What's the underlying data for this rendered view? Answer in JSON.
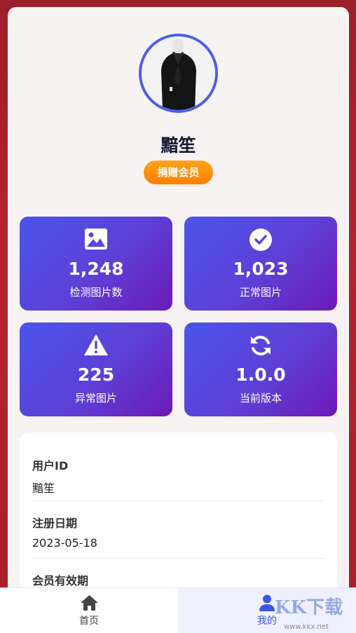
{
  "profile": {
    "name": "黯笙",
    "badge": "捐赠会员"
  },
  "stats": [
    {
      "icon": "image-icon",
      "value": "1,248",
      "label": "检测图片数"
    },
    {
      "icon": "check-circle-icon",
      "value": "1,023",
      "label": "正常图片"
    },
    {
      "icon": "warning-icon",
      "value": "225",
      "label": "异常图片"
    },
    {
      "icon": "refresh-icon",
      "value": "1.0.0",
      "label": "当前版本"
    }
  ],
  "info": [
    {
      "label": "用户ID",
      "value": "黯笙"
    },
    {
      "label": "注册日期",
      "value": "2023-05-18"
    },
    {
      "label": "会员有效期",
      "value": ""
    }
  ],
  "tabs": [
    {
      "label": "首页",
      "icon": "home-icon",
      "active": false
    },
    {
      "label": "我的",
      "icon": "user-icon",
      "active": true
    }
  ],
  "watermark": {
    "text": "KK下载",
    "url": "www.kkx.net"
  },
  "colors": {
    "accent": "#4d5ee8",
    "badge": "#ff8c00",
    "background": "#a51f2b",
    "stat_gradient_start": "#4a55ea",
    "stat_gradient_end": "#6c1ab6"
  }
}
